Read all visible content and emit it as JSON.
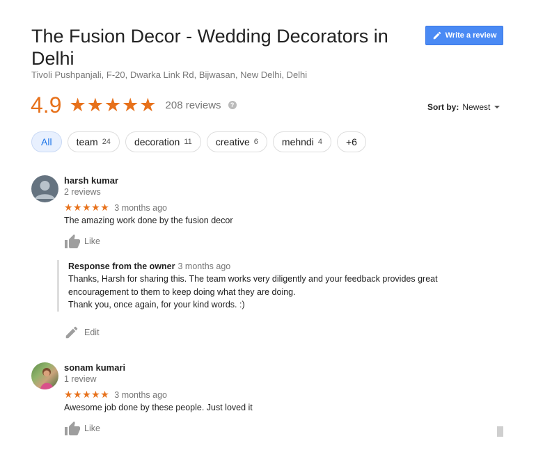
{
  "place": {
    "title": "The Fusion Decor - Wedding Decorators in Delhi",
    "address": "Tivoli Pushpanjali, F-20, Dwarka Link Rd, Bijwasan, New Delhi, Delhi"
  },
  "write_review": {
    "label": "Write a review",
    "icon": "pencil-icon"
  },
  "summary": {
    "rating": "4.9",
    "stars": "★★★★★",
    "reviews_text": "208 reviews",
    "help_glyph": "?"
  },
  "sort": {
    "label": "Sort by:",
    "value": "Newest"
  },
  "chips": [
    {
      "label": "All",
      "count": ""
    },
    {
      "label": "team",
      "count": "24"
    },
    {
      "label": "decoration",
      "count": "11"
    },
    {
      "label": "creative",
      "count": "6"
    },
    {
      "label": "mehndi",
      "count": "4"
    },
    {
      "label": "+6",
      "count": ""
    }
  ],
  "reviews": [
    {
      "author": "harsh kumar",
      "count": "2 reviews",
      "stars": "★★★★★",
      "time": "3 months ago",
      "text": "The amazing work done by the fusion decor",
      "like_label": "Like",
      "owner_response": {
        "label": "Response from the owner",
        "time": "3 months ago",
        "lines": [
          "Thanks, Harsh for sharing this. The team works very diligently and your feedback provides great",
          "encouragement to them to keep doing what they are doing.",
          "Thank you, once again, for your kind words. :)"
        ]
      },
      "edit_label": "Edit"
    },
    {
      "author": "sonam kumari",
      "count": "1 review",
      "stars": "★★★★★",
      "time": "3 months ago",
      "text": "Awesome job done by these people. Just loved it",
      "like_label": "Like"
    }
  ],
  "colors": {
    "accent_orange": "#e7711b",
    "button_blue": "#4a8af4",
    "chip_active": "#e8f0fe"
  }
}
